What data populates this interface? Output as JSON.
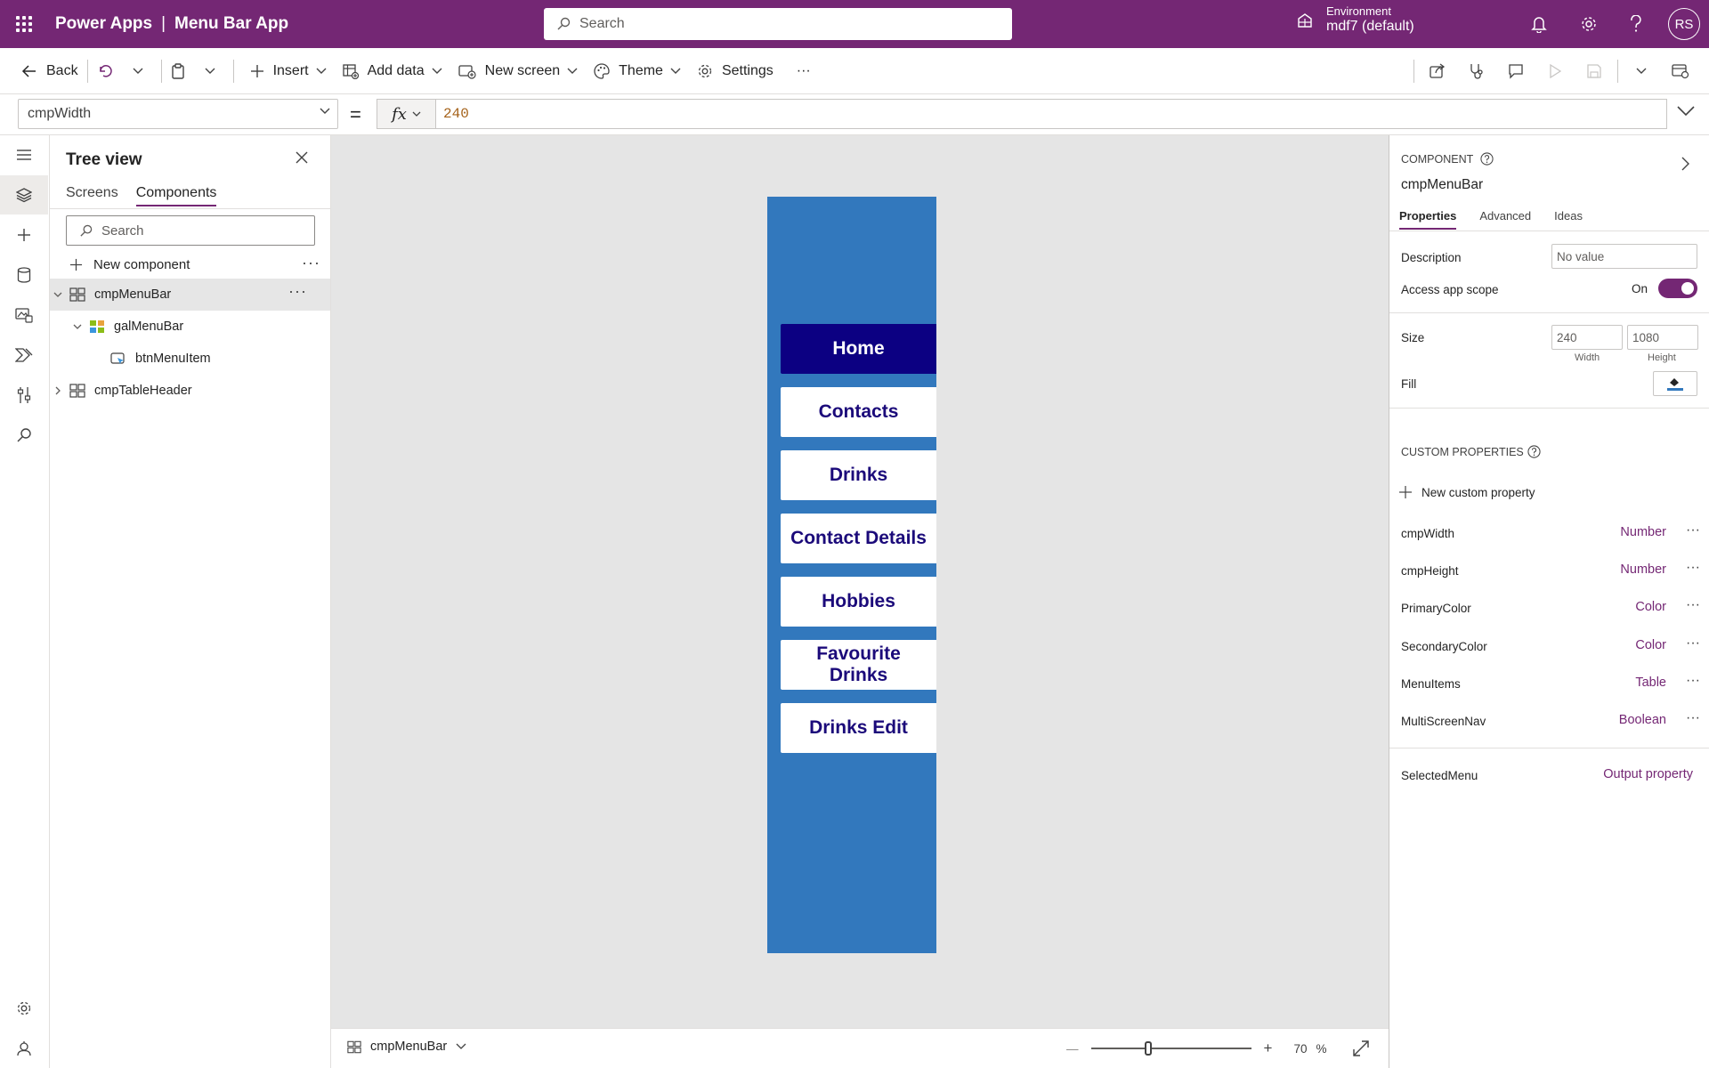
{
  "header": {
    "app_name": "Power Apps",
    "separator": "|",
    "app_title": "Menu Bar App",
    "search_placeholder": "Search",
    "env_label": "Environment",
    "env_name": "mdf7 (default)",
    "avatar_initials": "RS"
  },
  "toolbar": {
    "back": "Back",
    "insert": "Insert",
    "add_data": "Add data",
    "new_screen": "New screen",
    "theme": "Theme",
    "settings": "Settings",
    "more": "···"
  },
  "formula": {
    "property": "cmpWidth",
    "equals": "=",
    "fx": "fx",
    "value": "240"
  },
  "tree": {
    "title": "Tree view",
    "tabs": [
      "Screens",
      "Components"
    ],
    "active_tab": "Components",
    "search_placeholder": "Search",
    "new_component": "New component",
    "more": "···",
    "nodes": [
      {
        "label": "cmpMenuBar",
        "icon": "component-icon"
      },
      {
        "label": "galMenuBar",
        "icon": "gallery-icon"
      },
      {
        "label": "btnMenuItem",
        "icon": "button-icon"
      },
      {
        "label": "cmpTableHeader",
        "icon": "component-icon"
      }
    ]
  },
  "canvas": {
    "menu_items": [
      "Home",
      "Contacts",
      "Drinks",
      "Contact Details",
      "Hobbies",
      "Favourite Drinks",
      "Drinks Edit"
    ],
    "selected_item": "Home"
  },
  "statusbar": {
    "component": "cmpMenuBar",
    "zoom_value": "70",
    "zoom_unit": "%",
    "zoom_fraction": 0.36,
    "minus": "—",
    "plus": "+"
  },
  "properties": {
    "kind": "COMPONENT",
    "name": "cmpMenuBar",
    "tabs": [
      "Properties",
      "Advanced",
      "Ideas"
    ],
    "active_tab": "Properties",
    "description_label": "Description",
    "description_placeholder": "No value",
    "access_scope_label": "Access app scope",
    "access_scope_state": "On",
    "size_label": "Size",
    "width_value": "240",
    "height_value": "1080",
    "width_caption": "Width",
    "height_caption": "Height",
    "fill_label": "Fill",
    "fill_color": "#3278bd",
    "custom_heading": "CUSTOM PROPERTIES",
    "new_custom": "New custom property",
    "custom_props": [
      {
        "name": "cmpWidth",
        "type": "Number"
      },
      {
        "name": "cmpHeight",
        "type": "Number"
      },
      {
        "name": "PrimaryColor",
        "type": "Color"
      },
      {
        "name": "SecondaryColor",
        "type": "Color"
      },
      {
        "name": "MenuItems",
        "type": "Table"
      },
      {
        "name": "MultiScreenNav",
        "type": "Boolean"
      }
    ],
    "output_prop": {
      "name": "SelectedMenu",
      "type": "Output property"
    },
    "more": "···"
  },
  "colors": {
    "brand": "#742774",
    "menubar_bg": "#3278bd",
    "menu_active_bg": "#0c0082",
    "menu_text": "#1b0a7a"
  }
}
